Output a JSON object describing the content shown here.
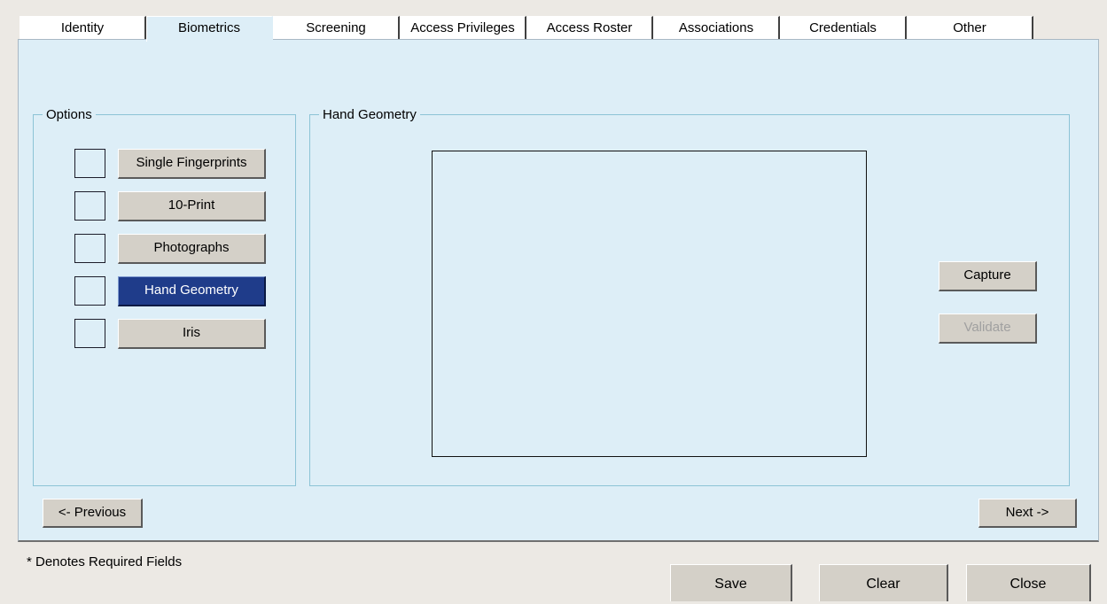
{
  "tabs": [
    {
      "label": "Identity"
    },
    {
      "label": "Biometrics"
    },
    {
      "label": "Screening"
    },
    {
      "label": "Access Privileges"
    },
    {
      "label": "Access Roster"
    },
    {
      "label": "Associations"
    },
    {
      "label": "Credentials"
    },
    {
      "label": "Other"
    }
  ],
  "active_tab": "Biometrics",
  "options": {
    "legend": "Options",
    "items": [
      {
        "label": "Single Fingerprints",
        "checked": false,
        "selected": false
      },
      {
        "label": "10-Print",
        "checked": false,
        "selected": false
      },
      {
        "label": "Photographs",
        "checked": false,
        "selected": false
      },
      {
        "label": "Hand Geometry",
        "checked": false,
        "selected": true
      },
      {
        "label": "Iris",
        "checked": false,
        "selected": false
      }
    ]
  },
  "capture_panel": {
    "legend": "Hand Geometry",
    "capture_label": "Capture",
    "validate_label": "Validate",
    "validate_enabled": false
  },
  "nav": {
    "previous_label": "<- Previous",
    "next_label": "Next ->"
  },
  "footer": {
    "required_note": "* Denotes Required Fields",
    "save_label": "Save",
    "clear_label": "Clear",
    "close_label": "Close"
  },
  "colors": {
    "panel_background": "#DDEEF7",
    "window_background": "#ECE9E4",
    "selected_option": "#1F3C8A",
    "group_border": "#8CC3D6",
    "button_face": "#D4D0C8"
  }
}
